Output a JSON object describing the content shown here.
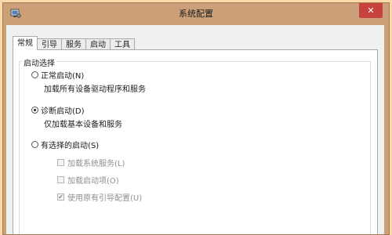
{
  "window": {
    "title": "系统配置",
    "close_symbol": "✕",
    "icon": "system-config-icon"
  },
  "tabs": [
    {
      "label": "常规",
      "active": true
    },
    {
      "label": "引导",
      "active": false
    },
    {
      "label": "服务",
      "active": false
    },
    {
      "label": "启动",
      "active": false
    },
    {
      "label": "工具",
      "active": false
    }
  ],
  "startup_selection": {
    "group_label": "启动选择",
    "normal": {
      "label": "正常启动(N)",
      "description": "加载所有设备驱动程序和服务",
      "checked": false
    },
    "diagnostic": {
      "label": "诊断启动(D)",
      "description": "仅加载基本设备和服务",
      "checked": true
    },
    "selective": {
      "label": "有选择的启动(S)",
      "checked": false,
      "options": {
        "load_system_services": {
          "label": "加载系统服务(L)",
          "checked": false,
          "enabled": false
        },
        "load_startup_items": {
          "label": "加载启动项(O)",
          "checked": false,
          "enabled": false
        },
        "use_original_boot_config": {
          "label": "使用原有引导配置(U)",
          "checked": true,
          "enabled": false,
          "mark": "✔"
        }
      }
    }
  }
}
